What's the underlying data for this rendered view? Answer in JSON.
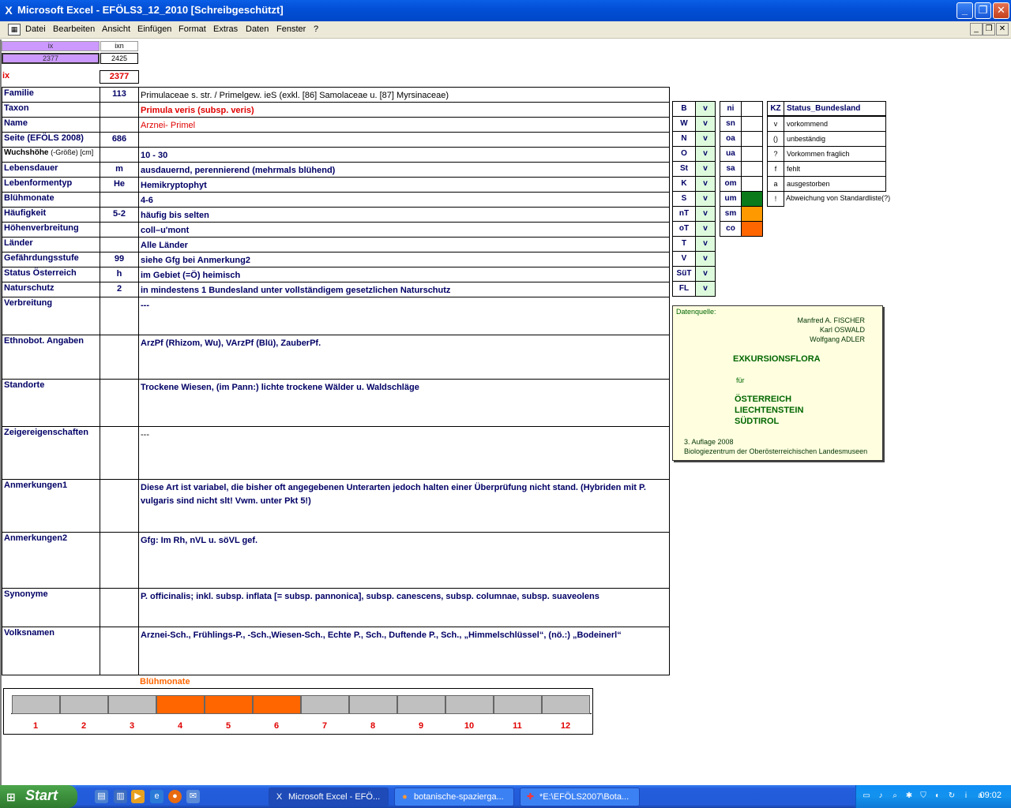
{
  "window": {
    "title": "Microsoft Excel - EFÖLS3_12_2010  [Schreibgeschützt]",
    "menus": [
      "Datei",
      "Bearbeiten",
      "Ansicht",
      "Einfügen",
      "Format",
      "Extras",
      "Daten",
      "Fenster",
      "?"
    ]
  },
  "top_cells": {
    "ix_header": "ix",
    "ixn_header": "ixn",
    "ix_value": "2377",
    "ixn_value": "2425",
    "ix_label": "ix",
    "ix_label_value": "2377"
  },
  "rows": [
    {
      "label": "Familie",
      "code": "113",
      "value": "Primulaceae s. str.  /  Primelgew. ieS (exkl. [86] Samolaceae u. [87] Myrsinaceae)"
    },
    {
      "label": "Taxon",
      "code": "",
      "value": "Primula veris (subsp. veris)"
    },
    {
      "label": "Name",
      "code": "",
      "value": "Arznei- Primel"
    },
    {
      "label": "Seite (EFÖLS 2008)",
      "code": "686",
      "value": ""
    },
    {
      "label": "Wuchshöhe",
      "label_suffix": "(-Größe) [cm]",
      "code": "",
      "value": " 10 - 30"
    },
    {
      "label": "Lebensdauer",
      "code": "m",
      "value": "ausdauernd, perennierend (mehrmals blühend)"
    },
    {
      "label": "Lebenformentyp",
      "code": "He",
      "value": "Hemikryptophyt"
    },
    {
      "label": "Blühmonate",
      "code": "",
      "value": " 4-6"
    },
    {
      "label": "Häufigkeit",
      "code": "5-2",
      "value": "häufig bis selten"
    },
    {
      "label": "Höhenverbreitung",
      "code": "",
      "value": "coll–u'mont"
    },
    {
      "label": "Länder",
      "code": "",
      "value": "Alle Länder"
    },
    {
      "label": "Gefährdungsstufe",
      "code": "99",
      "value": "siehe Gfg bei Anmerkung2"
    },
    {
      "label": "Status Österreich",
      "code": "h",
      "value": "im Gebiet (=Ö) heimisch"
    },
    {
      "label": "Naturschutz",
      "code": "2",
      "value": "in mindestens 1 Bundesland unter vollständigem gesetzlichen Naturschutz"
    },
    {
      "label": "Verbreitung",
      "code": "",
      "value": " ---"
    },
    {
      "label": "Ethnobot. Angaben",
      "code": "",
      "value": "ArzPf (Rhizom, Wu), VArzPf (Blü), ZauberPf."
    },
    {
      "label": "Standorte",
      "code": "",
      "value": "Trockene Wiesen, (im Pann:) lichte trockene Wälder u. Waldschläge"
    },
    {
      "label": "Zeigereigenschaften",
      "code": "",
      "value": "---"
    },
    {
      "label": "Anmerkungen1",
      "code": "",
      "value": "Diese Art ist variabel, die bisher oft angegebenen Unterarten jedoch halten einer Überprüfung nicht stand. (Hybriden mit P. vulgaris sind nicht slt!  Vwm. unter Pkt 5!)"
    },
    {
      "label": "Anmerkungen2",
      "code": "",
      "value": "Gfg:  Im Rh, nVL u. söVL gef."
    },
    {
      "label": "Synonyme",
      "code": "",
      "value": "P. officinalis; inkl. subsp. inflata [= subsp. pannonica], subsp. canescens, subsp. columnae, subsp. suaveolens"
    },
    {
      "label": "Volksnamen",
      "code": "",
      "value": "Arznei-Sch., Frühlings-P., -Sch.,Wiesen-Sch., Echte P., Sch.,   Duftende P., Sch., „Himmelschlüssel“, (nö.:) „Bodeinerl“"
    }
  ],
  "bundesland": [
    {
      "code": "B",
      "value": "v"
    },
    {
      "code": "W",
      "value": "v"
    },
    {
      "code": "N",
      "value": "v"
    },
    {
      "code": "O",
      "value": "v"
    },
    {
      "code": "St",
      "value": "v"
    },
    {
      "code": "K",
      "value": "v"
    },
    {
      "code": "S",
      "value": "v"
    },
    {
      "code": "nT",
      "value": "v"
    },
    {
      "code": "oT",
      "value": "v"
    },
    {
      "code": "T",
      "value": "v"
    },
    {
      "code": "V",
      "value": "v"
    },
    {
      "code": "SüT",
      "value": "v"
    },
    {
      "code": "FL",
      "value": "v"
    }
  ],
  "regions": [
    {
      "code": "ni",
      "color": ""
    },
    {
      "code": "sn",
      "color": ""
    },
    {
      "code": "oa",
      "color": ""
    },
    {
      "code": "ua",
      "color": ""
    },
    {
      "code": "sa",
      "color": ""
    },
    {
      "code": "om",
      "color": ""
    },
    {
      "code": "um",
      "color": "#0a7a1a"
    },
    {
      "code": "sm",
      "color": "#ff9900"
    },
    {
      "code": "co",
      "color": "#ff6600"
    }
  ],
  "legend": {
    "header_code": "KZ",
    "header_label": "Status_Bundesland",
    "items": [
      {
        "code": "v",
        "label": "vorkommend"
      },
      {
        "code": "()",
        "label": "unbeständig"
      },
      {
        "code": "?",
        "label": "Vorkommen fraglich"
      },
      {
        "code": "f",
        "label": "fehlt"
      },
      {
        "code": "a",
        "label": "ausgestorben"
      },
      {
        "code": "!",
        "label": "Abweichung von Standardliste(?)"
      }
    ]
  },
  "quelle": {
    "heading": "Datenquelle:",
    "authors": [
      "Manfred A. FISCHER",
      "Karl OSWALD",
      "Wolfgang ADLER"
    ],
    "book_title": "EXKURSIONSFLORA",
    "fuer": "für",
    "countries": [
      "ÖSTERREICH",
      "LIECHTENSTEIN",
      "SÜDTIROL"
    ],
    "edition": "3. Auflage 2008",
    "publisher": "Biologiezentrum der Oberösterreichischen Landesmuseen"
  },
  "bloom_chart": {
    "title": "Blühmonate",
    "months": [
      "1",
      "2",
      "3",
      "4",
      "5",
      "6",
      "7",
      "8",
      "9",
      "10",
      "11",
      "12"
    ],
    "active": [
      false,
      false,
      false,
      true,
      true,
      true,
      false,
      false,
      false,
      false,
      false,
      false
    ],
    "active_color": "#ff6600",
    "inactive_color": "#c0c0c0"
  },
  "taskbar": {
    "start_label": "Start",
    "tasks": [
      "Microsoft Excel - EFÖ...",
      "botanische-spazierga...",
      "*E:\\EFÖLS2007\\Bota..."
    ],
    "clock": "09:02"
  }
}
